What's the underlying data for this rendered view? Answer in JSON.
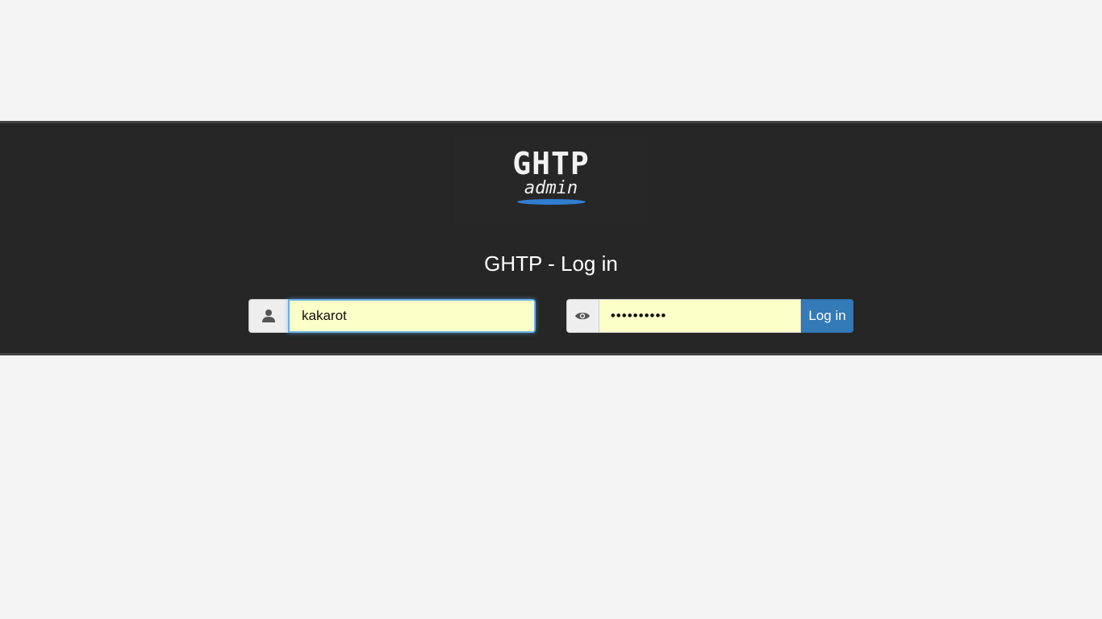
{
  "logo": {
    "title": "GHTP",
    "subtitle": "admin",
    "accent_color": "#2f7fd0"
  },
  "login": {
    "heading": "GHTP - Log in",
    "username_icon": "user-icon",
    "username_value": "kakarot",
    "password_icon": "eye-icon",
    "password_value": "••••••••••",
    "submit_label": "Log in"
  },
  "colors": {
    "band_background": "#262626",
    "page_background": "#f4f4f4",
    "autofill_background": "#fbffc8",
    "primary_button": "#337ab7"
  }
}
